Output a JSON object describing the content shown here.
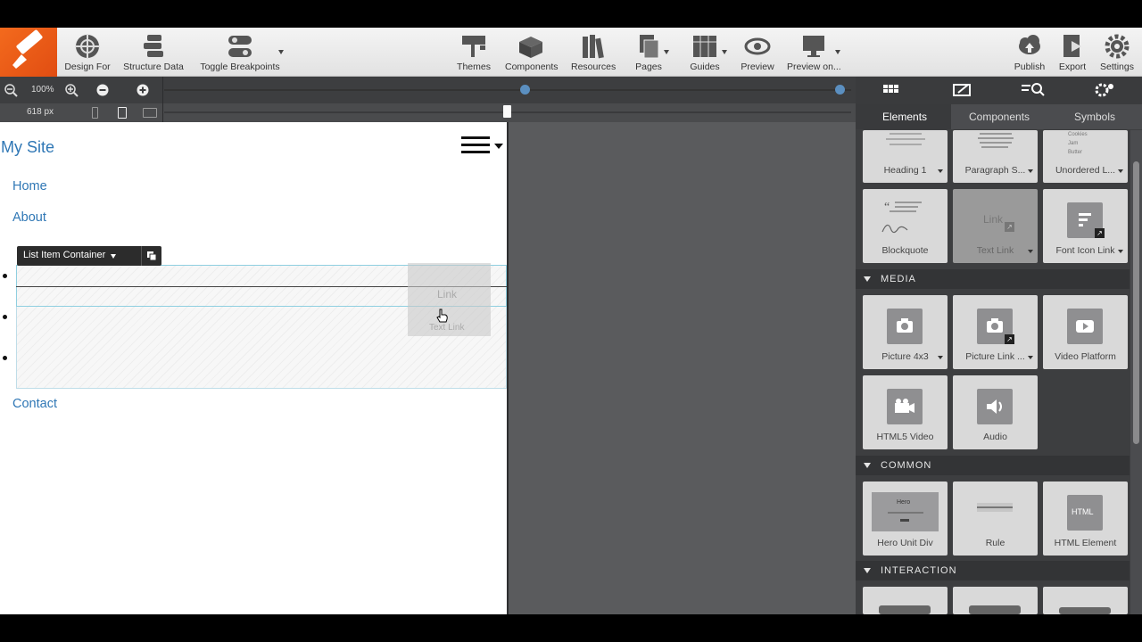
{
  "toolbar": {
    "left": [
      {
        "label": "Design For"
      },
      {
        "label": "Structure Data"
      },
      {
        "label": "Toggle Breakpoints"
      }
    ],
    "center": [
      {
        "label": "Themes"
      },
      {
        "label": "Components"
      },
      {
        "label": "Resources"
      },
      {
        "label": "Pages"
      },
      {
        "label": "Guides"
      },
      {
        "label": "Preview"
      },
      {
        "label": "Preview on..."
      }
    ],
    "right": [
      {
        "label": "Publish"
      },
      {
        "label": "Export"
      },
      {
        "label": "Settings"
      }
    ]
  },
  "zoom": {
    "percent": "100%"
  },
  "width": {
    "value": "618 px"
  },
  "canvas": {
    "site_title": "My Site",
    "nav": [
      "Home",
      "About",
      "Contact"
    ],
    "context_menu": {
      "label": "List Item Container"
    },
    "drag_ghost": {
      "mini": "Link",
      "label": "Text Link"
    }
  },
  "panel": {
    "subtabs": [
      "Elements",
      "Components",
      "Symbols"
    ],
    "cards_top": [
      "Heading 1",
      "Paragraph S...",
      "Unordered L..."
    ],
    "cards_row2": [
      "Blockquote",
      "Text Link",
      "Font Icon Link"
    ],
    "sections": [
      "MEDIA",
      "COMMON",
      "INTERACTION"
    ],
    "media": [
      "Picture 4x3",
      "Picture Link ...",
      "Video Platform",
      "HTML5 Video",
      "Audio"
    ],
    "common": [
      "Hero Unit Div",
      "Rule",
      "HTML Element"
    ],
    "hero_mini": "Hero",
    "html_mini": "HTML",
    "ul_mini": [
      "Cookies",
      "Jam",
      "Butter"
    ],
    "link_mini": "Link"
  },
  "colors": {
    "accent": "#f36a1d",
    "link": "#2f77b5",
    "selection": "#8fcfe0"
  }
}
